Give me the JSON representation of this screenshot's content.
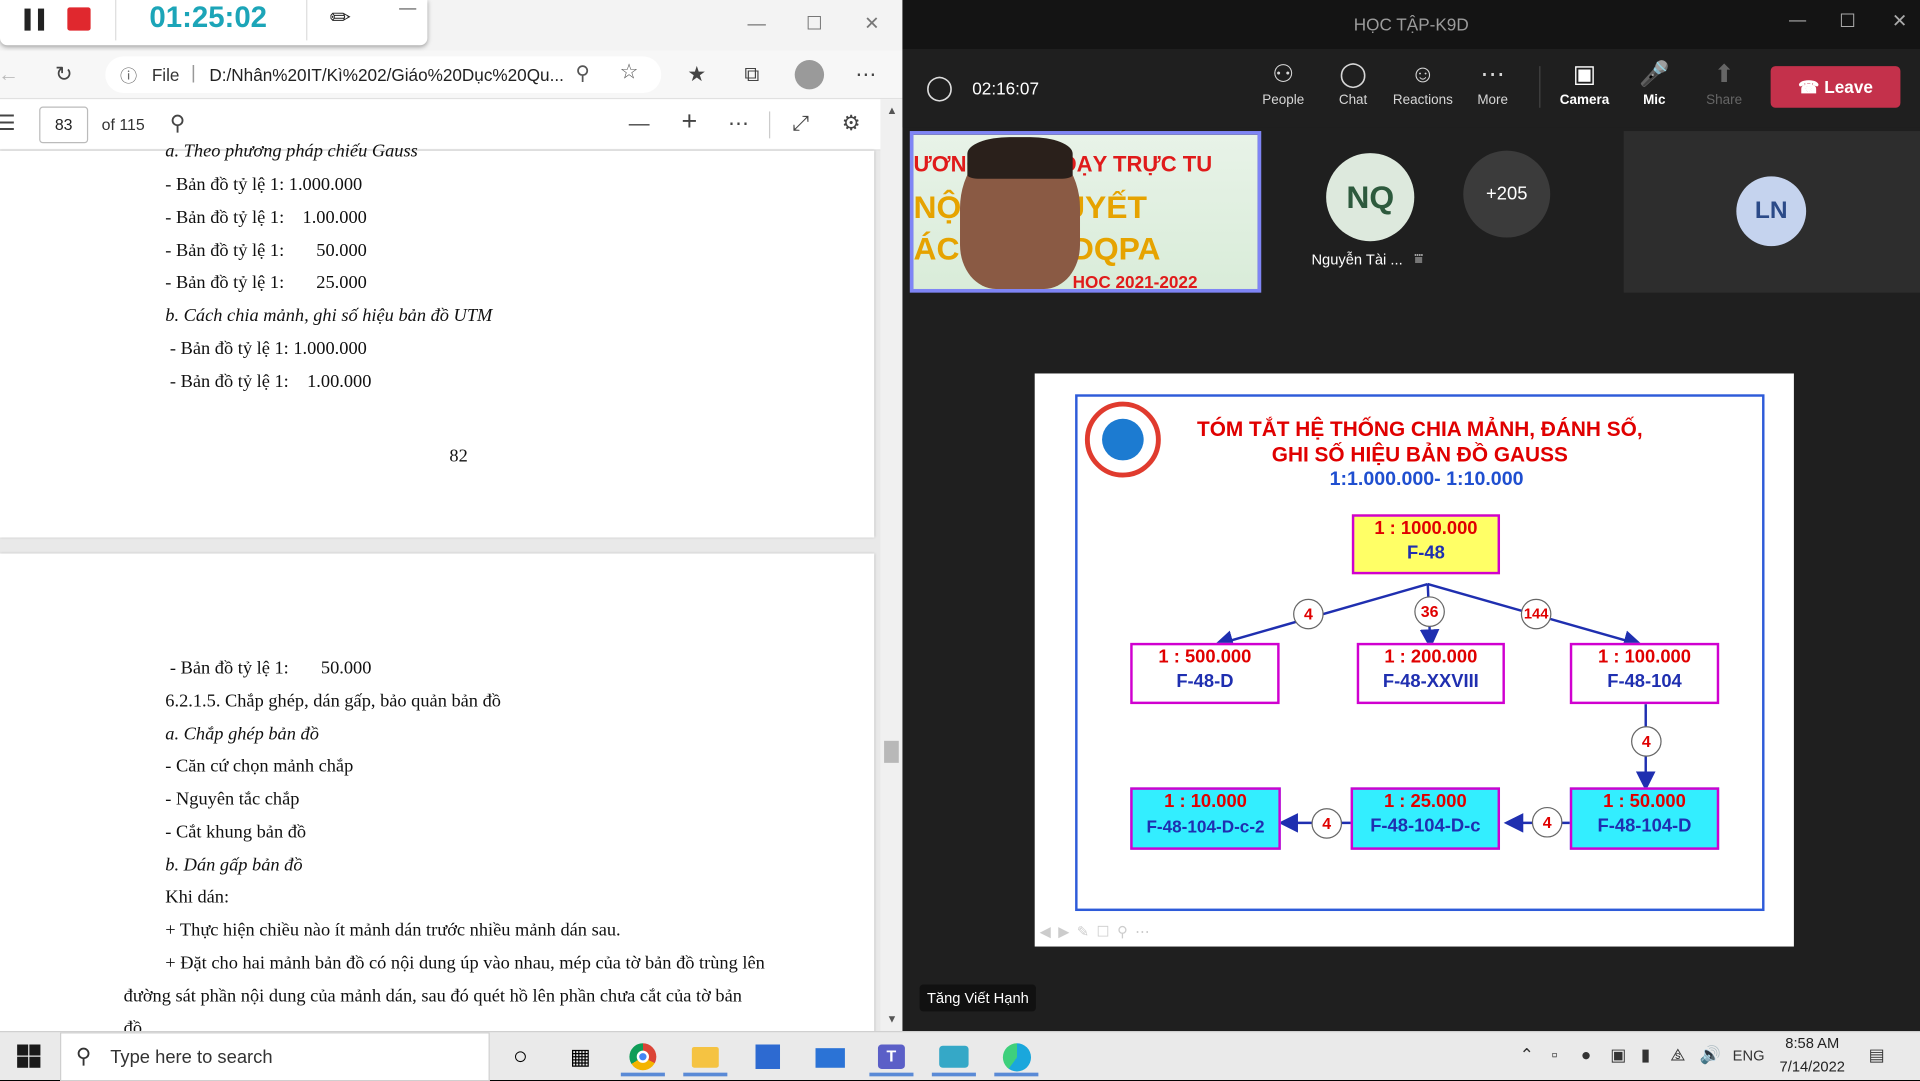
{
  "recorder": {
    "timer": "01:25:02"
  },
  "edge": {
    "address": {
      "scheme": "File",
      "url": "D:/Nhân%20IT/Kì%202/Giáo%20Dục%20Qu..."
    },
    "pdf": {
      "page": "83",
      "of": "of 115"
    },
    "page1_lines": [
      "a. Theo phương pháp chiếu Gauss",
      "- Bản đồ tỷ lệ 1: 1.000.000",
      "- Bản đồ tỷ lệ 1:    1.00.000",
      "- Bản đồ tỷ lệ 1:       50.000",
      "- Bản đồ tỷ lệ 1:       25.000",
      "b. Cách chia mảnh, ghi số hiệu bản đồ UTM",
      " - Bản đồ tỷ lệ 1: 1.000.000",
      " - Bản đồ tỷ lệ 1:    1.00.000"
    ],
    "page1_number": "82",
    "page2_lines": [
      " - Bản đồ tỷ lệ 1:       50.000",
      "6.2.1.5. Chắp ghép, dán gấp, bảo quản bản đồ",
      "a. Chắp ghép bản đồ",
      "- Căn cứ chọn mảnh chắp",
      "- Nguyên tắc chắp",
      "- Cắt khung bản đồ",
      "b. Dán gấp bản đồ",
      "Khi dán:",
      "+ Thực hiện chiều nào ít mảnh dán trước nhiều mảnh dán sau.",
      "+ Đặt cho hai mảnh bản đồ có nội dung úp vào nhau, mép của tờ bản đồ trùng lên",
      "đường sát phần nội dung của mảnh dán, sau đó quét hồ lên phần chưa cắt của tờ bản",
      "đồ"
    ]
  },
  "teams": {
    "title": "HỌC TẬP-K9D",
    "call_time": "02:16:07",
    "toolbar": [
      {
        "label": "People",
        "icon": "people-icon"
      },
      {
        "label": "Chat",
        "icon": "chat-icon"
      },
      {
        "label": "Reactions",
        "icon": "reactions-icon"
      },
      {
        "label": "More",
        "icon": "more-icon"
      },
      {
        "label": "Camera",
        "icon": "camera-off-icon"
      },
      {
        "label": "Mic",
        "icon": "mic-off-icon"
      },
      {
        "label": "Share",
        "icon": "share-icon"
      }
    ],
    "leave": "Leave",
    "participants": {
      "nq_initials": "NQ",
      "nq_name": "Nguyễn Tài ...",
      "overflow": "+205",
      "ln_initials": "LN"
    },
    "video_banner": "ƯƠNG    HÀNG DẠY TRỰC TU",
    "video_banner2": "NỘ    LÝ THUYẾT",
    "video_banner3": "ÁC     HẨN GDQPA",
    "video_banner4": "HỌC 2021-2022",
    "presenter": "Tăng Viết Hạnh",
    "slide": {
      "title1": "TÓM TẮT HỆ THỐNG CHIA MẢNH, ĐÁNH SỐ,",
      "title2": "GHI SỐ HIỆU BẢN ĐỒ GAUSS",
      "subtitle": "1:1.000.000- 1:10.000",
      "boxes": {
        "top": {
          "scale": "1 : 1000.000",
          "code": "F-48"
        },
        "b500": {
          "scale": "1 : 500.000",
          "code": "F-48-D"
        },
        "b200": {
          "scale": "1 : 200.000",
          "code": "F-48-XXVIII"
        },
        "b100": {
          "scale": "1 : 100.000",
          "code": "F-48-104"
        },
        "b50": {
          "scale": "1 : 50.000",
          "code": "F-48-104-D"
        },
        "b25": {
          "scale": "1 : 25.000",
          "code": "F-48-104-D-c"
        },
        "b10": {
          "scale": "1 : 10.000",
          "code": "F-48-104-D-c-2"
        }
      },
      "nums": {
        "n1": "4",
        "n2": "36",
        "n3": "144",
        "n4": "4",
        "n5": "4",
        "n6": "4"
      }
    }
  },
  "taskbar": {
    "search_placeholder": "Type here to search",
    "lang": "ENG",
    "time": "8:58 AM",
    "date": "7/14/2022"
  },
  "colors": {
    "leave": "#c4314b",
    "box_yellow": "#ffff66",
    "box_cyan": "#33eeff",
    "box_border": "#d000d0",
    "title_red": "#e00000",
    "title_blue": "#1f4fd0"
  }
}
